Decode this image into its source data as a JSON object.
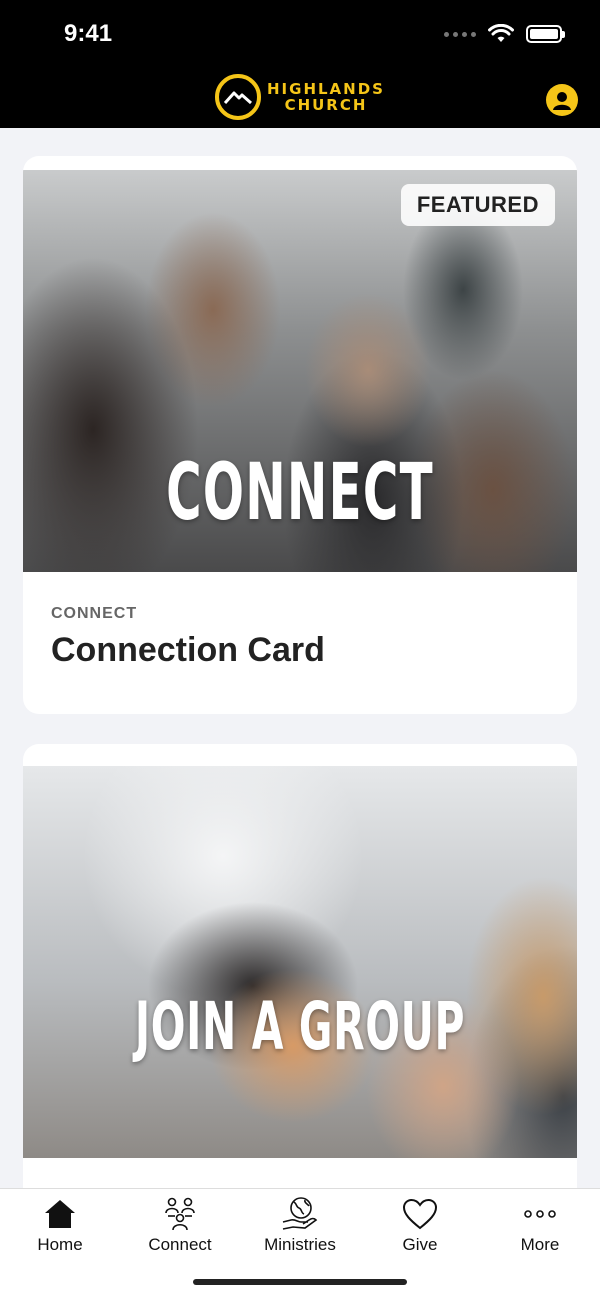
{
  "status_bar": {
    "time": "9:41"
  },
  "header": {
    "logo_line1": "HIGHLANDS",
    "logo_line2": "CHURCH",
    "logo_icon": "mountain-icon",
    "profile_icon": "user-icon",
    "accent_color": "#f5c518"
  },
  "cards": [
    {
      "badge": "FEATURED",
      "image_title": "CONNECT",
      "category": "CONNECT",
      "title": "Connection Card"
    },
    {
      "image_title": "JOIN A GROUP"
    }
  ],
  "tabs": [
    {
      "label": "Home",
      "icon": "home-icon"
    },
    {
      "label": "Connect",
      "icon": "people-icon"
    },
    {
      "label": "Ministries",
      "icon": "globe-hand-icon"
    },
    {
      "label": "Give",
      "icon": "heart-icon"
    },
    {
      "label": "More",
      "icon": "more-dots-icon"
    }
  ]
}
